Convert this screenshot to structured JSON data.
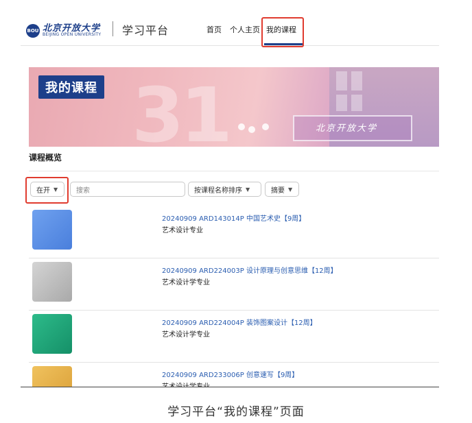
{
  "header": {
    "logo_mark": "BOU",
    "logo_cn": "北京开放大学",
    "logo_en": "BEIJING OPEN UNIVERSITY",
    "platform": "学习平台",
    "nav": [
      {
        "label": "首页"
      },
      {
        "label": "个人主页"
      },
      {
        "label": "我的课程",
        "active": true
      }
    ]
  },
  "banner": {
    "title": "我的课程",
    "plate_text": "北京开放大学"
  },
  "overview": {
    "title": "课程概览",
    "filter_label": "在开",
    "search_placeholder": "搜索",
    "sort_label": "按课程名称排序",
    "view_label": "摘要"
  },
  "courses": [
    {
      "title": "20240909 ARD143014P 中国艺术史【9周】",
      "major": "艺术设计专业",
      "color": "#5b8fe6"
    },
    {
      "title": "20240909 ARD224003P 设计原理与创意思维【12周】",
      "major": "艺术设计学专业",
      "color": "#bcbcbc"
    },
    {
      "title": "20240909 ARD224004P 装饰图案设计【12周】",
      "major": "艺术设计学专业",
      "color": "#1fa97a"
    },
    {
      "title": "20240909 ARD233006P 创意速写【9周】",
      "major": "艺术设计学专业",
      "color": "#e8b24a"
    }
  ],
  "caption": "学习平台“我的课程”页面",
  "colors": {
    "brand": "#1d3f8a",
    "highlight": "#e03b2e",
    "link": "#2a5db0"
  }
}
